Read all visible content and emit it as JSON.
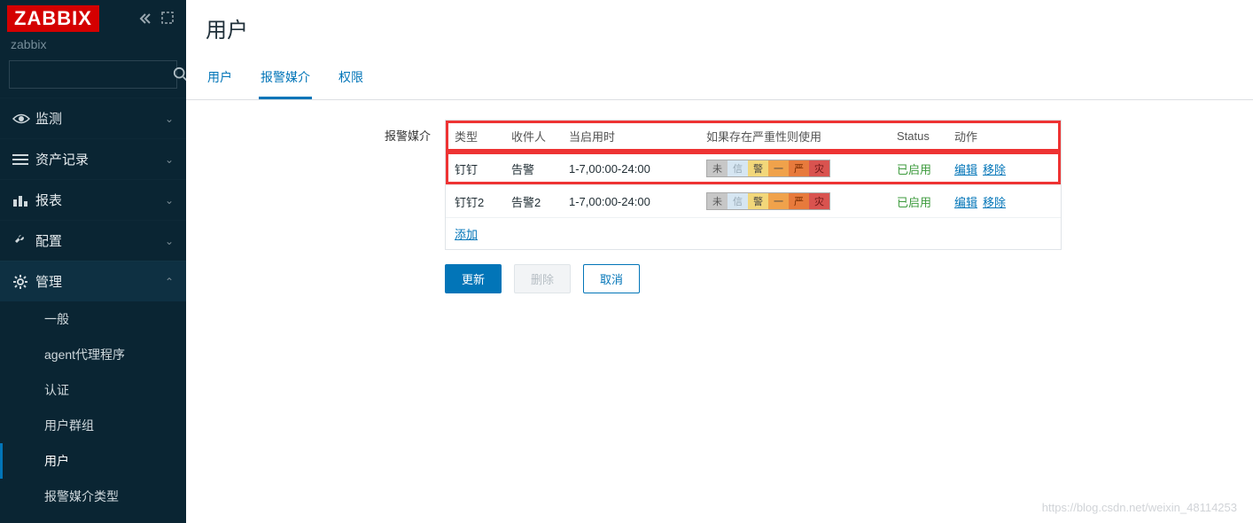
{
  "brand": {
    "logo": "ZABBIX",
    "sub": "zabbix"
  },
  "search": {
    "placeholder": ""
  },
  "nav": {
    "items": [
      {
        "label": "监测",
        "icon": "eye"
      },
      {
        "label": "资产记录",
        "icon": "list"
      },
      {
        "label": "报表",
        "icon": "bar"
      },
      {
        "label": "配置",
        "icon": "wrench"
      },
      {
        "label": "管理",
        "icon": "gear",
        "expanded": true
      }
    ],
    "admin_sub": [
      {
        "label": "一般"
      },
      {
        "label": "agent代理程序"
      },
      {
        "label": "认证"
      },
      {
        "label": "用户群组"
      },
      {
        "label": "用户",
        "active": true
      },
      {
        "label": "报警媒介类型"
      }
    ]
  },
  "page": {
    "title": "用户"
  },
  "tabs": [
    {
      "label": "用户"
    },
    {
      "label": "报警媒介",
      "active": true
    },
    {
      "label": "权限"
    }
  ],
  "form": {
    "media_label": "报警媒介"
  },
  "media_table": {
    "headers": {
      "type": "类型",
      "sendto": "收件人",
      "when": "当启用时",
      "severity": "如果存在严重性则使用",
      "status": "Status",
      "actions": "动作"
    },
    "rows": [
      {
        "type": "钉钉",
        "sendto": "告警",
        "when": "1-7,00:00-24:00",
        "status": "已启用",
        "edit": "编辑",
        "remove": "移除",
        "highlight": true
      },
      {
        "type": "钉钉2",
        "sendto": "告警2",
        "when": "1-7,00:00-24:00",
        "status": "已启用",
        "edit": "编辑",
        "remove": "移除"
      }
    ],
    "sev_labels": [
      "未",
      "信",
      "警",
      "一",
      "严",
      "灾"
    ],
    "add": "添加"
  },
  "buttons": {
    "update": "更新",
    "delete": "删除",
    "cancel": "取消"
  },
  "watermark": "https://blog.csdn.net/weixin_48114253"
}
